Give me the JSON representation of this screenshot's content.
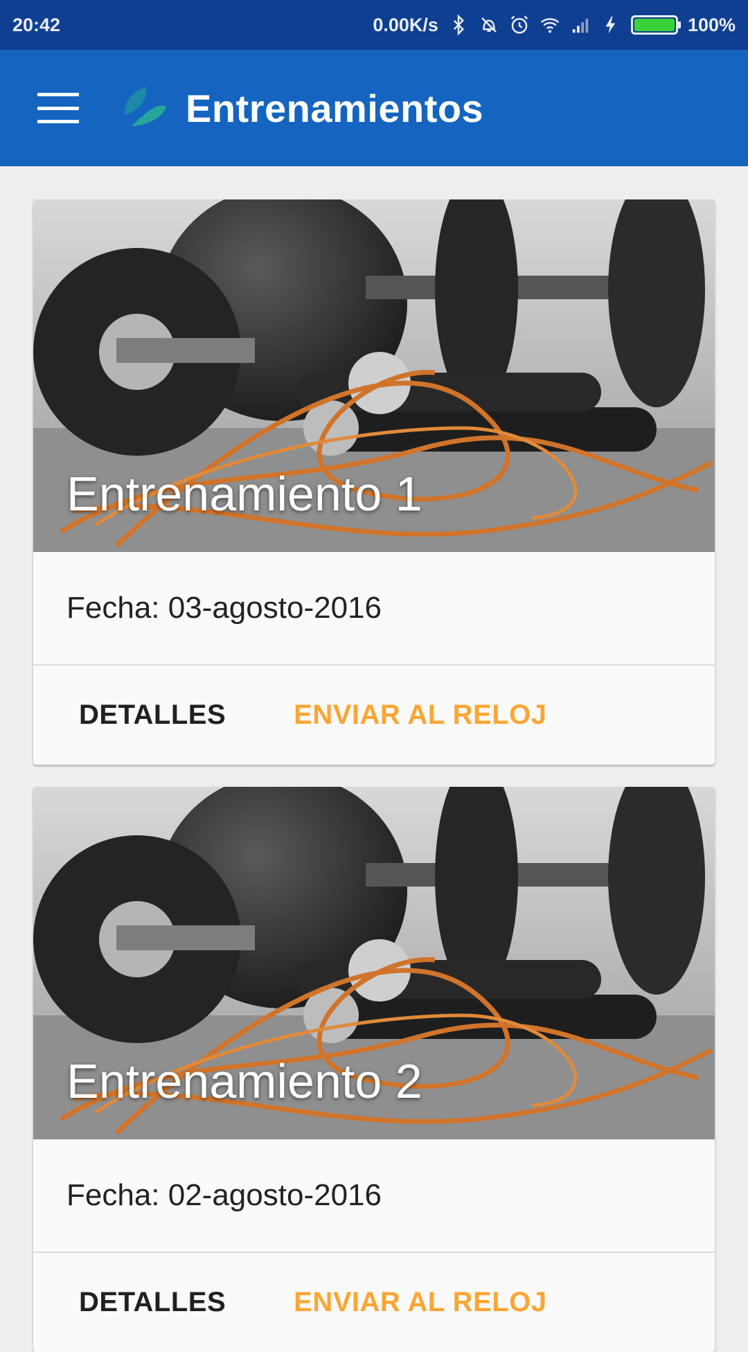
{
  "status_bar": {
    "time": "20:42",
    "net_speed": "0.00K/s",
    "battery_level": "100%",
    "battery_fill_fraction": 1.0,
    "icons": [
      "bluetooth-icon",
      "vibrate-icon",
      "alarm-icon",
      "wifi-icon",
      "signal-icon",
      "charging-icon",
      "battery-icon"
    ]
  },
  "app_bar": {
    "title": "Entrenamientos",
    "menu_icon": "hamburger-menu-icon",
    "logo_icon": "app-logo-icon",
    "color": "#1565c0"
  },
  "workouts": [
    {
      "title": "Entrenamiento 1",
      "date": "Fecha: 03-agosto-2016",
      "details_label": "DETALLES",
      "send_label": "ENVIAR AL RELOJ",
      "image": "jump-rope-dumbbell-photo"
    },
    {
      "title": "Entrenamiento 2",
      "date": "Fecha: 02-agosto-2016",
      "details_label": "DETALLES",
      "send_label": "ENVIAR AL RELOJ",
      "image": "jump-rope-dumbbell-photo"
    }
  ],
  "colors": {
    "status_bar": "#0e3f91",
    "accent_button": "#ffa533",
    "background": "#eeeeee"
  }
}
